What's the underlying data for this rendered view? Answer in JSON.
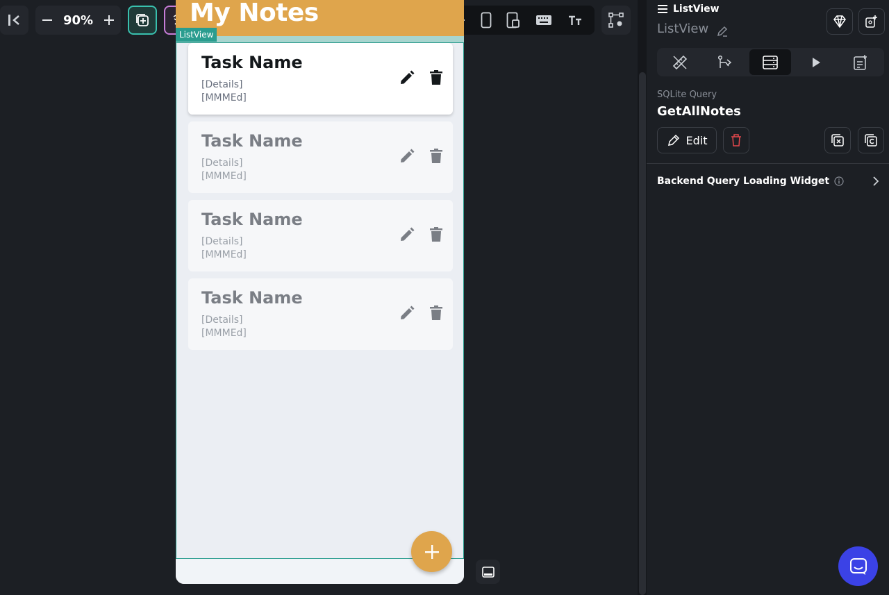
{
  "toolbar": {
    "zoom_label": "90%",
    "collapse_icon": "collapse-left-icon",
    "zoom_out_icon": "minus-icon",
    "zoom_in_icon": "plus-icon"
  },
  "app": {
    "title": "My Notes",
    "listview_tag": "ListView",
    "accent": "#dfa54c",
    "selection": "#2a9d8f"
  },
  "cards": [
    {
      "task": "Task Name",
      "details": "[Details]",
      "date": "[MMMEd]"
    },
    {
      "task": "Task Name",
      "details": "[Details]",
      "date": "[MMMEd]"
    },
    {
      "task": "Task Name",
      "details": "[Details]",
      "date": "[MMMEd]"
    },
    {
      "task": "Task Name",
      "details": "[Details]",
      "date": "[MMMEd]"
    }
  ],
  "panel": {
    "widget_type": "ListView",
    "widget_name": "ListView",
    "query_label": "SQLite Query",
    "query_name": "GetAllNotes",
    "edit_label": "Edit",
    "loading_label": "Backend Query Loading Widget"
  }
}
